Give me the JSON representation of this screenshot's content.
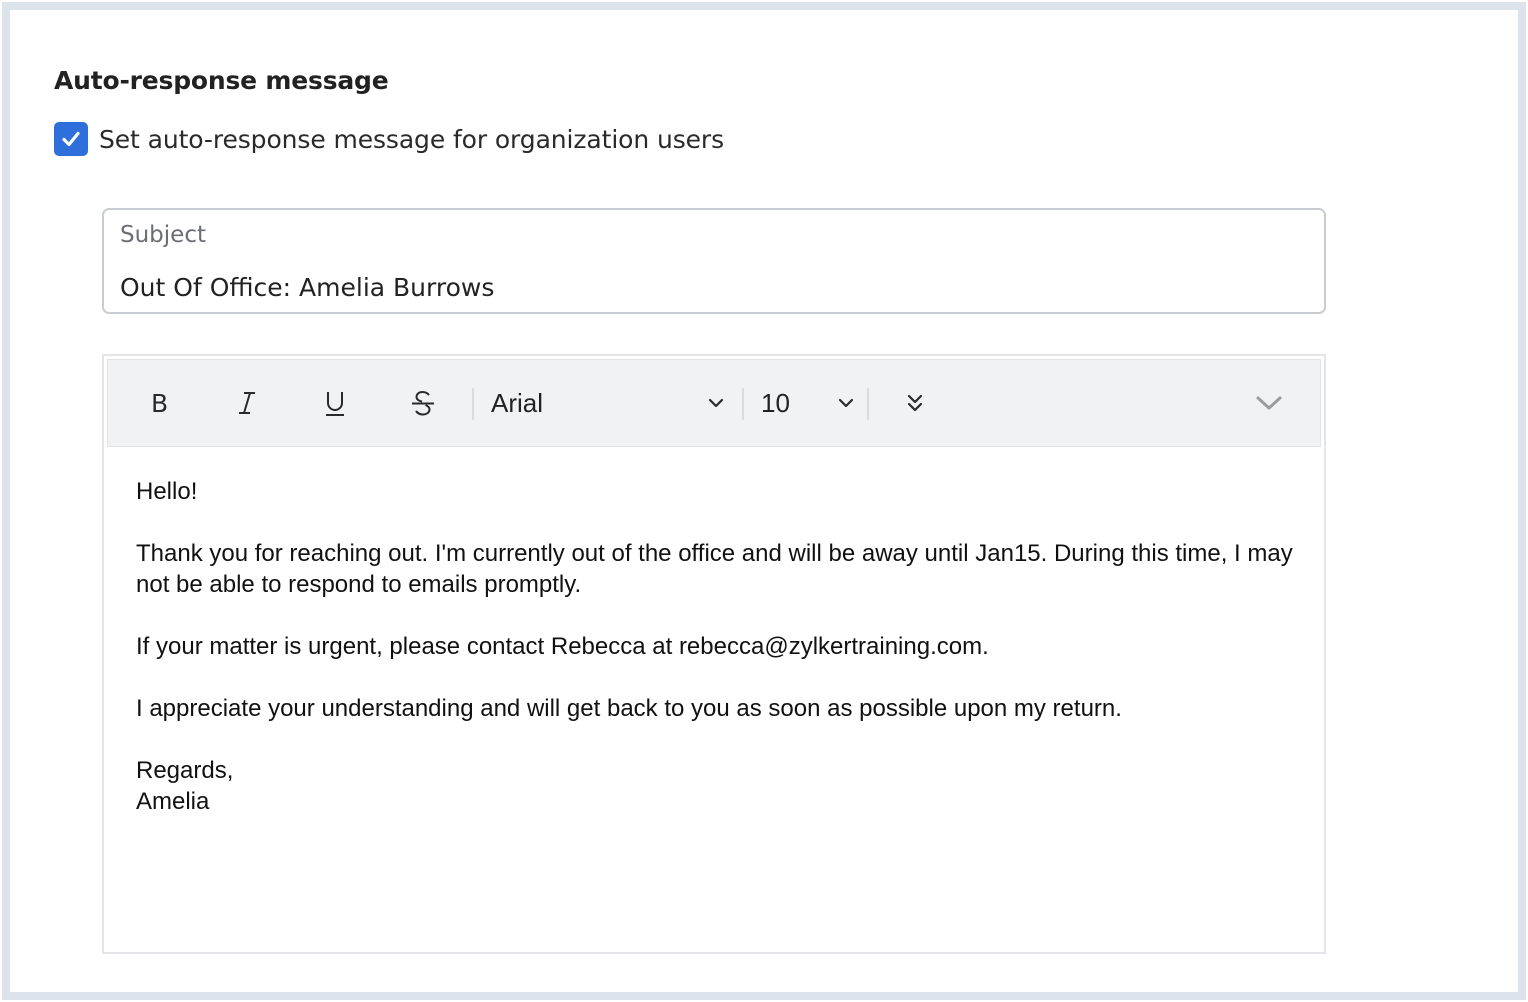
{
  "section": {
    "title": "Auto-response message",
    "checkbox_label": "Set auto-response message for organization users",
    "checkbox_checked": true
  },
  "subject": {
    "label": "Subject",
    "value": "Out Of Office: Amelia Burrows"
  },
  "toolbar": {
    "bold_icon": "bold-icon",
    "italic_icon": "italic-icon",
    "underline_icon": "underline-icon",
    "strikethrough_icon": "strikethrough-icon",
    "font_family": "Arial",
    "font_size": "10",
    "more_icon": "double-chevron-down-icon",
    "collapse_icon": "chevron-down-icon"
  },
  "message": {
    "greeting": "Hello!",
    "paragraph1": "Thank you for reaching out. I'm currently out of the office and will be away until Jan15. During this time, I may not be able to respond to emails promptly.",
    "paragraph2": "If your matter is urgent, please contact Rebecca at rebecca@zylkertraining.com.",
    "paragraph3": "I appreciate your understanding and will get back to you as soon as possible upon my return.",
    "signoff": "Regards,",
    "signature": "Amelia"
  },
  "colors": {
    "accent": "#2f6fdb",
    "frame_border": "#dde3ea",
    "toolbar_bg": "#f1f2f4"
  }
}
